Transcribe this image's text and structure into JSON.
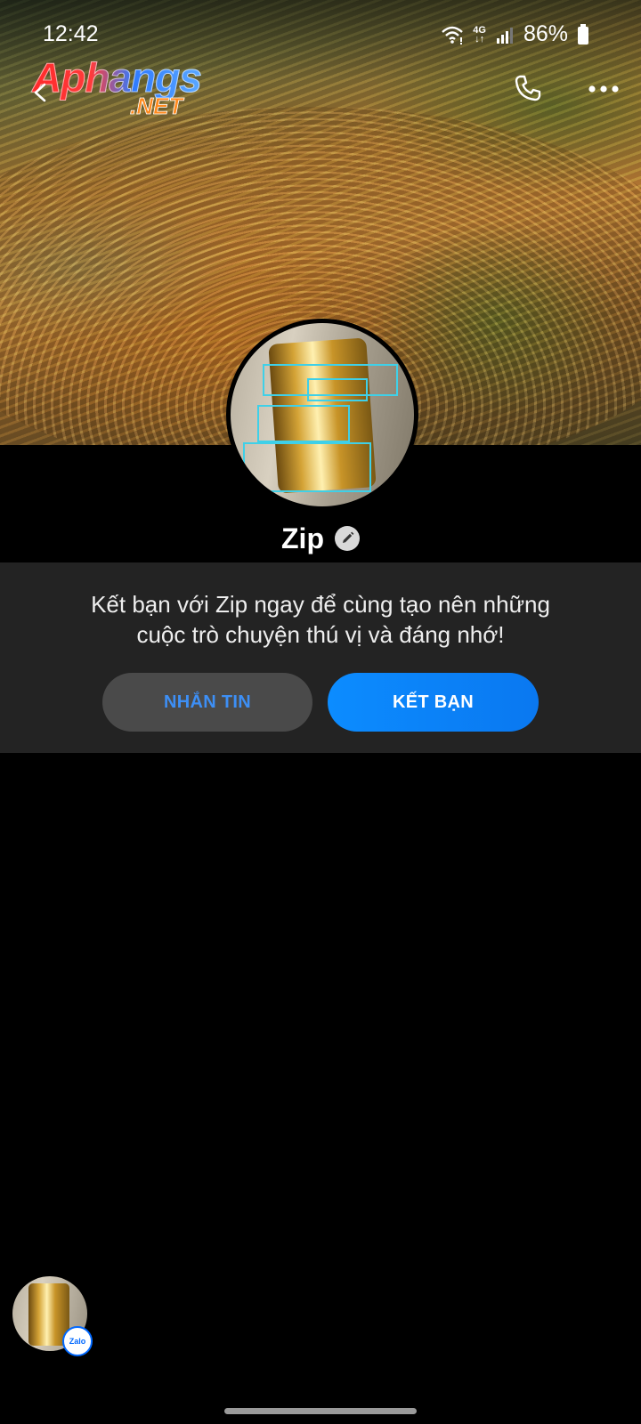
{
  "status_bar": {
    "time": "12:42",
    "network_top": "4G",
    "network_bottom": "↓↑",
    "battery": "86%"
  },
  "watermark": {
    "main": "Aphangs",
    "sub": ".NET"
  },
  "header": {
    "back_icon": "back-arrow-icon",
    "call_icon": "phone-icon",
    "more_icon": "more-dots-icon"
  },
  "profile": {
    "name": "Zip",
    "intro_line1": "Kết bạn với Zip ngay để cùng tạo nên những",
    "intro_line2": "cuộc trò chuyện thú vị và đáng nhớ!",
    "message_button": "NHẮN TIN",
    "add_friend_button": "KẾT BẠN"
  },
  "chat_head": {
    "badge": "Zalo"
  },
  "colors": {
    "accent": "#0a84ff",
    "message_text": "#3d8ff5",
    "panel": "#232323"
  }
}
